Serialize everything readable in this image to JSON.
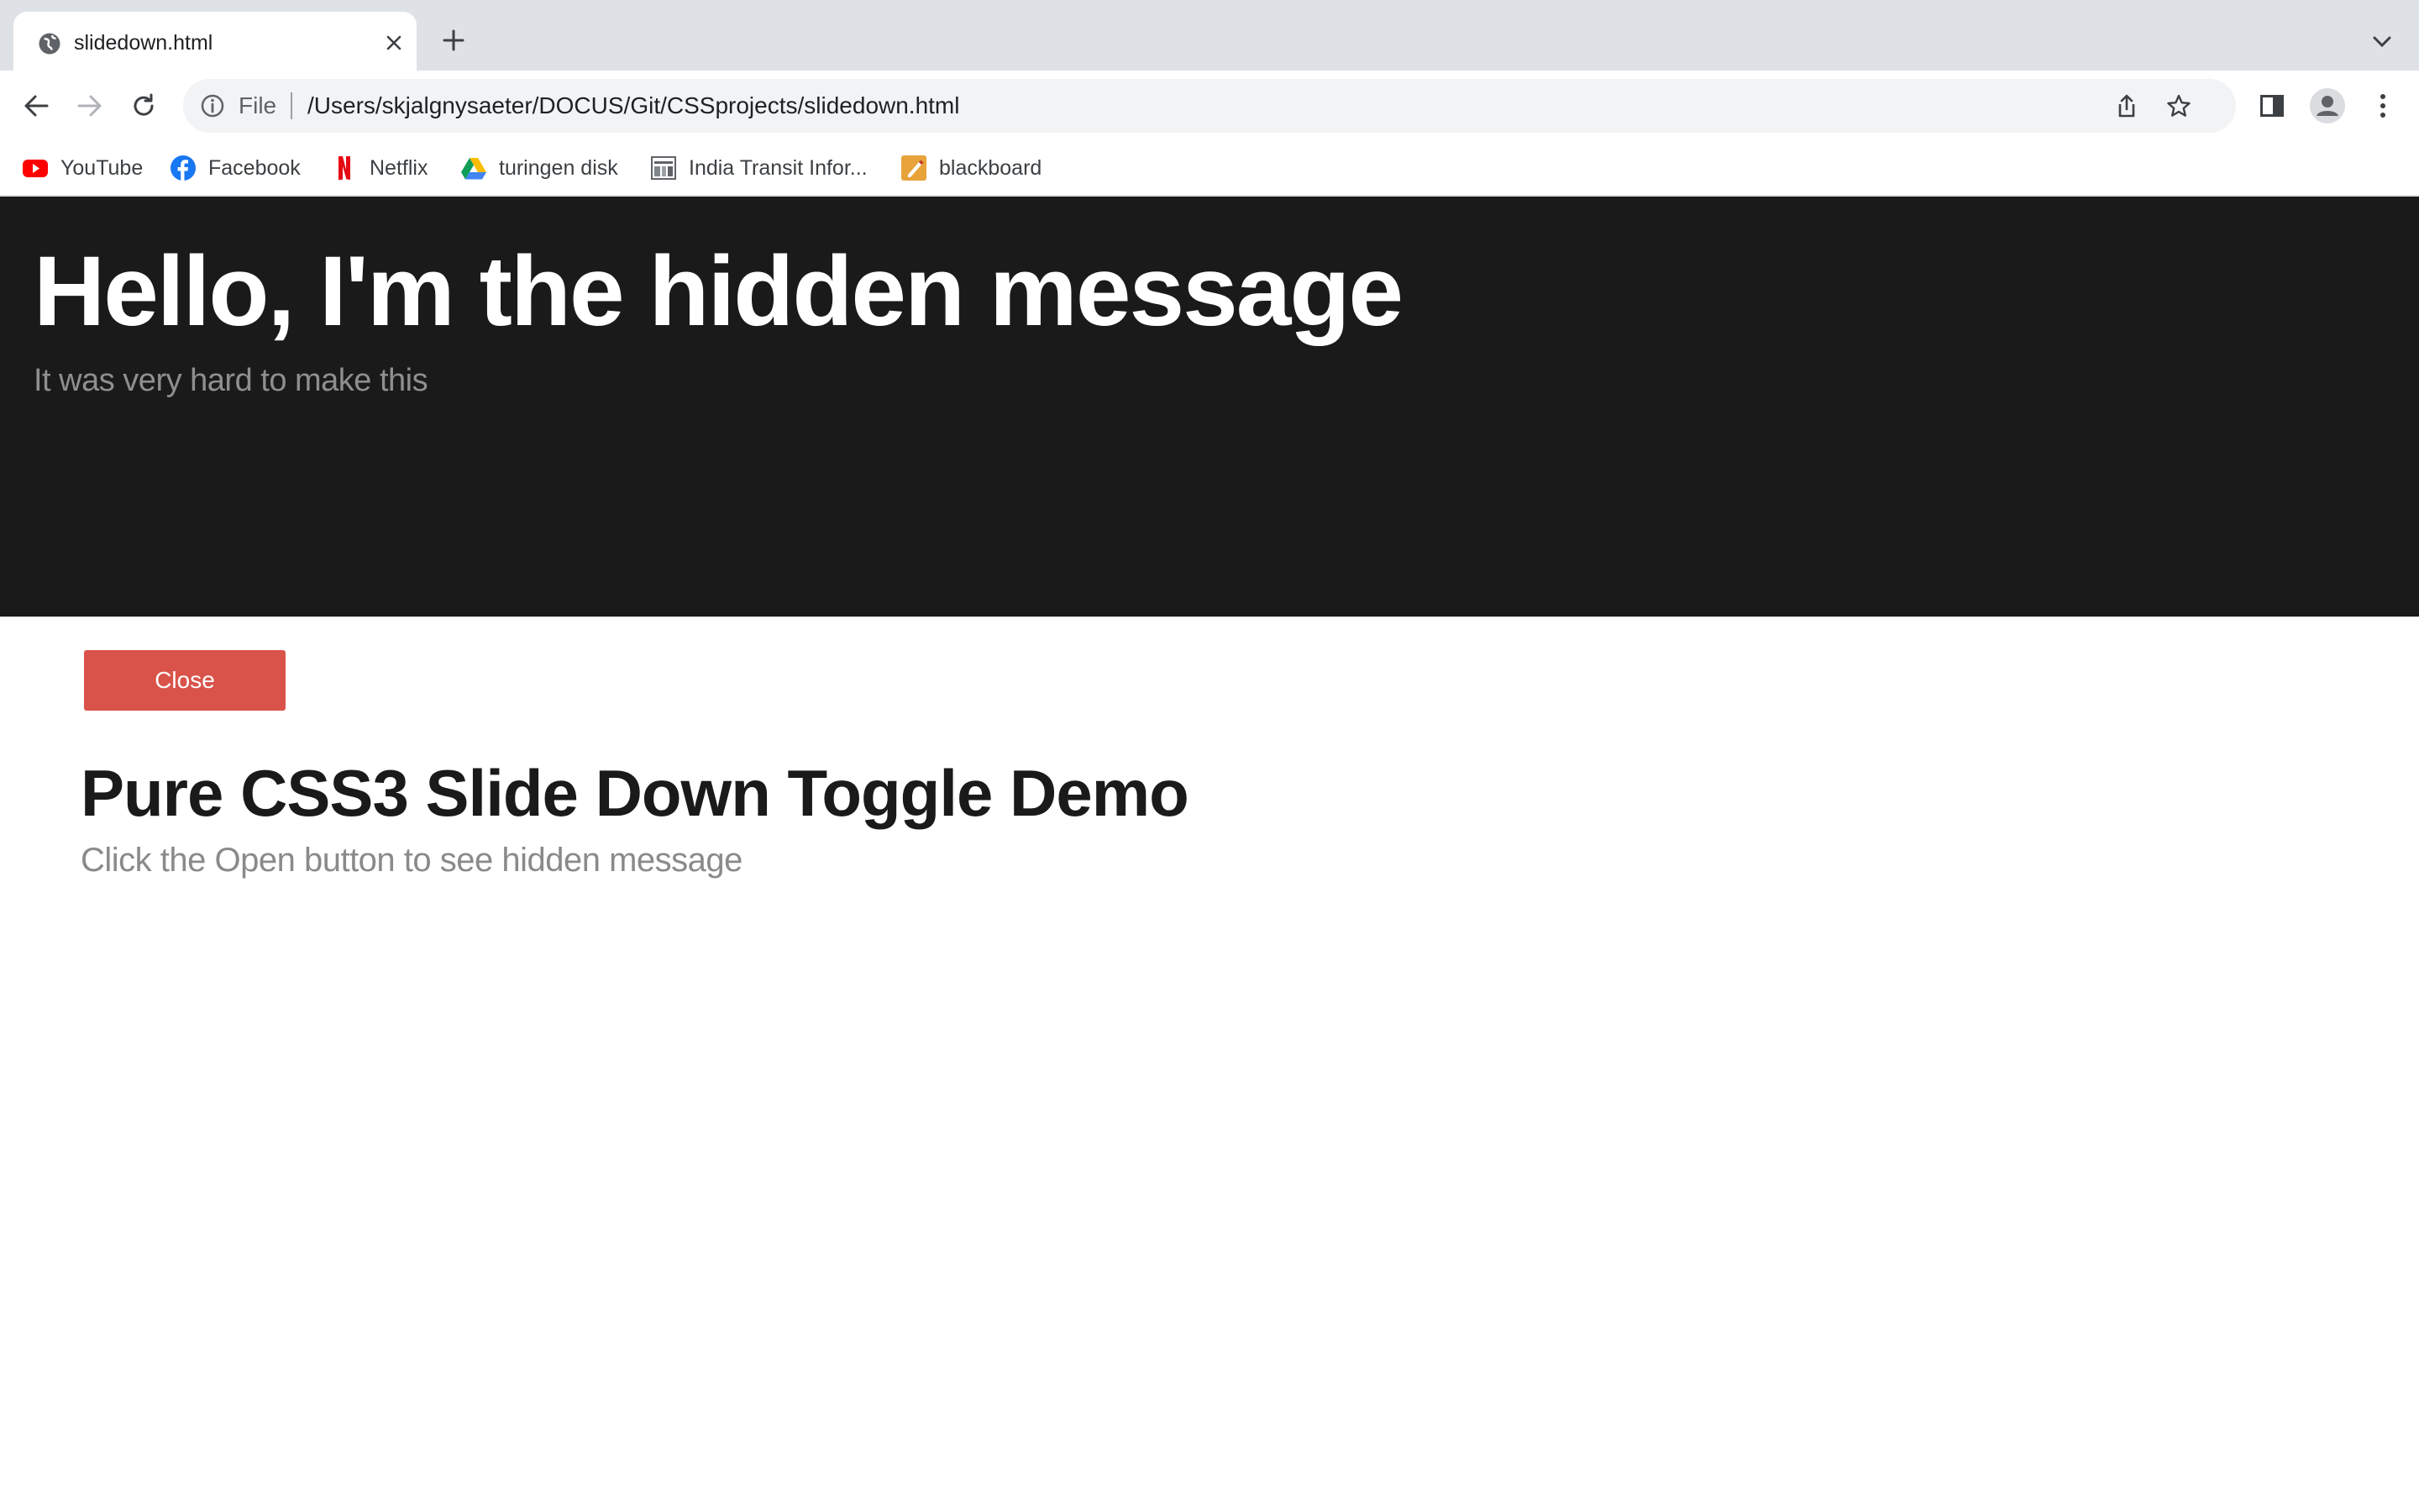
{
  "browser": {
    "tab": {
      "title": "slidedown.html"
    },
    "omnibox": {
      "scheme_label": "File",
      "url": "/Users/skjalgnysaeter/DOCUS/Git/CSSprojects/slidedown.html"
    },
    "bookmarks": [
      {
        "label": "YouTube",
        "icon": "youtube-icon"
      },
      {
        "label": "Facebook",
        "icon": "facebook-icon"
      },
      {
        "label": "Netflix",
        "icon": "netflix-icon"
      },
      {
        "label": "turingen disk",
        "icon": "google-drive-icon"
      },
      {
        "label": "India Transit Infor...",
        "icon": "transit-icon"
      },
      {
        "label": "blackboard",
        "icon": "blackboard-icon"
      }
    ]
  },
  "page": {
    "hidden_message": {
      "title": "Hello, I'm the hidden message",
      "subtitle": "It was very hard to make this"
    },
    "toggle_button_label": "Close",
    "demo": {
      "title": "Pure CSS3 Slide Down Toggle Demo",
      "subtitle": "Click the Open button to see hidden message"
    }
  },
  "colors": {
    "panel_background": "#1a1a1a",
    "button_red": "#d9534a",
    "tabstrip_gray": "#dee1e6"
  }
}
